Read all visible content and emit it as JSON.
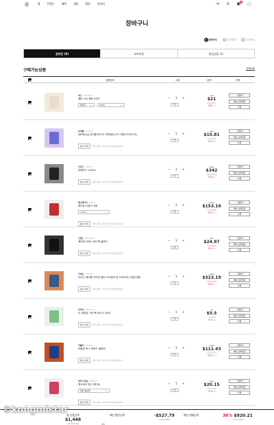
{
  "header": {
    "nav": [
      "홈",
      "트렌드",
      "혜택",
      "세일",
      "랭킹",
      "럭셔리"
    ],
    "cart_badge": "9"
  },
  "page_title": "장바구니",
  "steps": [
    {
      "num": "1",
      "label": "장바구니"
    },
    {
      "num": "2",
      "label": "주문결제"
    },
    {
      "num": "3",
      "label": "주문완료"
    }
  ],
  "tabs": [
    "온라인 (9)",
    "오프라인",
    "관심상품 (1)"
  ],
  "section": {
    "title": "구매가능상품",
    "delete_selected": "선택삭제"
  },
  "table_headers": {
    "product": "상품정보",
    "qty": "수량",
    "price": "금액",
    "choice": "선택"
  },
  "buttons": {
    "wish": "♡ 찜하기",
    "order": "해외 선택주문",
    "delete": "삭제",
    "qty_change": "변경"
  },
  "items": [
    {
      "brand": "바오",
      "code": "BAO0021",
      "name": "해피 스트 팬티 5SET",
      "opt1": "베이지",
      "opt2": "S(95)",
      "qty": "1",
      "orig": "$34",
      "price": "$21",
      "krw": "(30,464원)",
      "disc": "38% ↓",
      "colors": [
        "#e8dccb",
        "#f1e9dc"
      ]
    },
    {
      "brand": "유이벨",
      "code": "YUI0012",
      "name": "[화이트닝] 유이벨 마스크 기획세트(시드 파워+모이스처)",
      "opt_btn": "옵션 선택",
      "notice": "해외 중개는 선택시 일괄 발송 예정입니다",
      "qty": "1",
      "orig": "$21",
      "price": "$15.81",
      "krw": "(22,938원)",
      "disc": "25% ↓",
      "colors": [
        "#6b6bd6",
        "#d7c6f0"
      ]
    },
    {
      "brand": "크리드",
      "code": "CRE001",
      "name": "어벤투스 100ml",
      "opt_btn": "옵션 선택",
      "notice": "해외 중개는 선택시 일괄 발송 예정입니다",
      "qty": "1",
      "orig": "$456",
      "price": "$342",
      "krw": "(495,900원)",
      "disc": "25% ↓",
      "colors": [
        "#222222",
        "#8a8a8a"
      ]
    },
    {
      "brand": "헤스페나리",
      "code": "HES11",
      "name": "화이트 디퓨즈 세트",
      "opt1": "130*2",
      "opt_btn": "옵션 선택",
      "notice": "해외 중개는 선택시 일괄 발송 예정입니다",
      "qty": "1",
      "orig": "$270",
      "price": "$153.16",
      "krw": "(222,083원)",
      "disc": "43% ↓",
      "colors": [
        "#c03030",
        "#eeeeee"
      ]
    },
    {
      "brand": "브랜드",
      "code": "BRA0009",
      "name": "쉐이퍼 크로스 바디백 블랙 S",
      "opt_btn": "옵션 선택",
      "notice": "해외 중개는 선택시 일괄 발송 예정입니다",
      "qty": "1",
      "orig": "$50",
      "price": "$24.97",
      "krw": "(36,210원)",
      "disc": "50% ↓",
      "colors": [
        "#111111",
        "#333333"
      ]
    },
    {
      "brand": "다이슨",
      "code": "DYS001",
      "name": "다이슨 에어랩 오리진 멀티 스타일러 앤 드라이어 [사형/긴형]",
      "opt_btn": "옵션 선택",
      "notice": "해외 중개는 선택시 일괄 발송 예정입니다",
      "qty": "1",
      "orig": "$488",
      "price": "$323.19",
      "krw": "(468,628원)",
      "disc": "34% ↓",
      "colors": [
        "#3a5a8a",
        "#d98a5a"
      ]
    },
    {
      "brand": "닥터지",
      "code": "DRG0018",
      "name": "더 센트럴 그린 팩 마스크 10매",
      "opt_btn": "옵션 선택",
      "notice": "해외 중개는 선택시 일괄 발송 예정입니다",
      "qty": "1",
      "orig": "$8",
      "price": "$5.5",
      "krw": "(7,975원)",
      "disc": "31% ↓",
      "colors": [
        "#7cc08a",
        "#e5f2e7"
      ]
    },
    {
      "brand": "카발란",
      "code": "KAV001",
      "name": "카발란 독스 바머드 셀렉션",
      "opt_btn": "옵션 선택",
      "notice": "해외 중개는 선택시 일괄 발송 예정입니다",
      "qty": "1",
      "orig": "$232",
      "price": "$111.43",
      "krw": "(161,573원)",
      "disc": "52% ↓",
      "colors": [
        "#1f3f8a",
        "#c05020"
      ]
    },
    {
      "brand": "바비 브라운",
      "code": "BOB001",
      "name": "체스트리 립스 에디트",
      "opt1": "해외 옵션명",
      "opt_btn": "옵션 선택",
      "notice": "해외 중개는 선택시 일괄 발송 예정입니다",
      "qty": "1",
      "orig": "$47",
      "price": "$20.15",
      "krw": "(29,217원)",
      "disc": "57% ↓",
      "colors": [
        "#d04060",
        "#f0f0f0"
      ]
    }
  ],
  "footer": {
    "total_label": "총 상품금액",
    "total": "$1,448",
    "total_krw": "(2,099,547원)",
    "discount_label": "예상 할인금액",
    "discount": "-$527.79",
    "discount_krw": "(-765,298원)",
    "pay_label": "예상 결제금액",
    "pay_pct": "36%",
    "pay": "$920.21",
    "pay_krw": "(1,334,306원)"
  },
  "watermark": "©kongmistar"
}
